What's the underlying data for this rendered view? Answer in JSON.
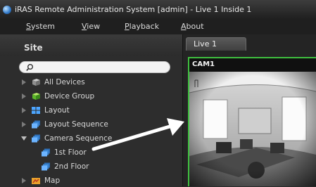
{
  "window": {
    "title": "iRAS Remote Administration System [admin] - Live 1  Inside 1"
  },
  "menu": [
    {
      "accel": "S",
      "rest": "ystem"
    },
    {
      "accel": "V",
      "rest": "iew"
    },
    {
      "accel": "P",
      "rest": "layback"
    },
    {
      "accel": "A",
      "rest": "bout"
    }
  ],
  "sidebar": {
    "title": "Site",
    "search": {
      "placeholder": "",
      "value": ""
    },
    "tree": [
      {
        "label": "All Devices",
        "expanded": false,
        "icon": "all-devices-icon"
      },
      {
        "label": "Device Group",
        "expanded": false,
        "icon": "device-group-icon"
      },
      {
        "label": "Layout",
        "expanded": false,
        "icon": "layout-icon"
      },
      {
        "label": "Layout Sequence",
        "expanded": false,
        "icon": "layout-sequence-icon"
      },
      {
        "label": "Camera Sequence",
        "expanded": true,
        "icon": "camera-sequence-icon"
      },
      {
        "label": "1st Floor",
        "child": true,
        "icon": "camera-sequence-icon"
      },
      {
        "label": "2nd Floor",
        "child": true,
        "icon": "camera-sequence-icon"
      },
      {
        "label": "Map",
        "expanded": false,
        "icon": "map-icon"
      }
    ]
  },
  "tabs": [
    {
      "label": "Live  1",
      "active": true
    }
  ],
  "camera": {
    "name": "CAM1"
  },
  "colors": {
    "selection_border": "#3fbf3f",
    "background": "#2b2b2b",
    "annotation_arrow": "#ffffff"
  }
}
